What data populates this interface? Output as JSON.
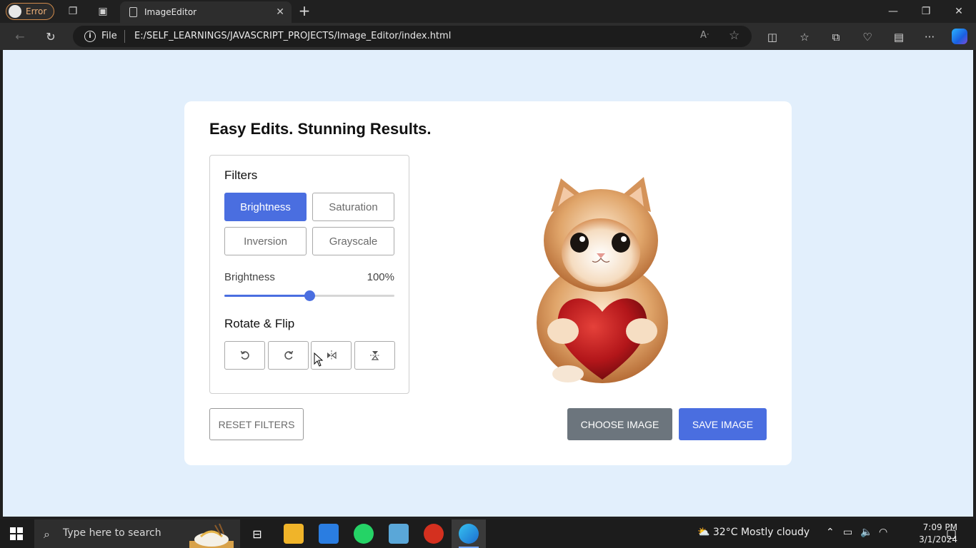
{
  "browser": {
    "profile_label": "Error",
    "tab_title": "ImageEditor",
    "address": {
      "scheme_label": "File",
      "url": "E:/SELF_LEARNINGS/JAVASCRIPT_PROJECTS/Image_Editor/index.html"
    }
  },
  "app": {
    "title": "Easy Edits. Stunning Results.",
    "filters": {
      "heading": "Filters",
      "buttons": [
        "Brightness",
        "Saturation",
        "Inversion",
        "Grayscale"
      ],
      "active": "Brightness"
    },
    "slider": {
      "label": "Brightness",
      "value_text": "100%",
      "fraction": 0.5
    },
    "rotate": {
      "heading": "Rotate & Flip",
      "icons": [
        "rotate-left-icon",
        "rotate-right-icon",
        "flip-horizontal-icon",
        "flip-vertical-icon"
      ]
    },
    "actions": {
      "reset": "RESET FILTERS",
      "choose": "CHOOSE IMAGE",
      "save": "SAVE IMAGE"
    },
    "colors": {
      "accent": "#4a6ee0",
      "choose": "#6c757d",
      "background": "#e2effc"
    }
  },
  "taskbar": {
    "search_placeholder": "Type here to search",
    "weather": {
      "temp": "32°C",
      "condition": "Mostly cloudy"
    },
    "time": "7:09 PM",
    "date": "3/1/2024"
  }
}
